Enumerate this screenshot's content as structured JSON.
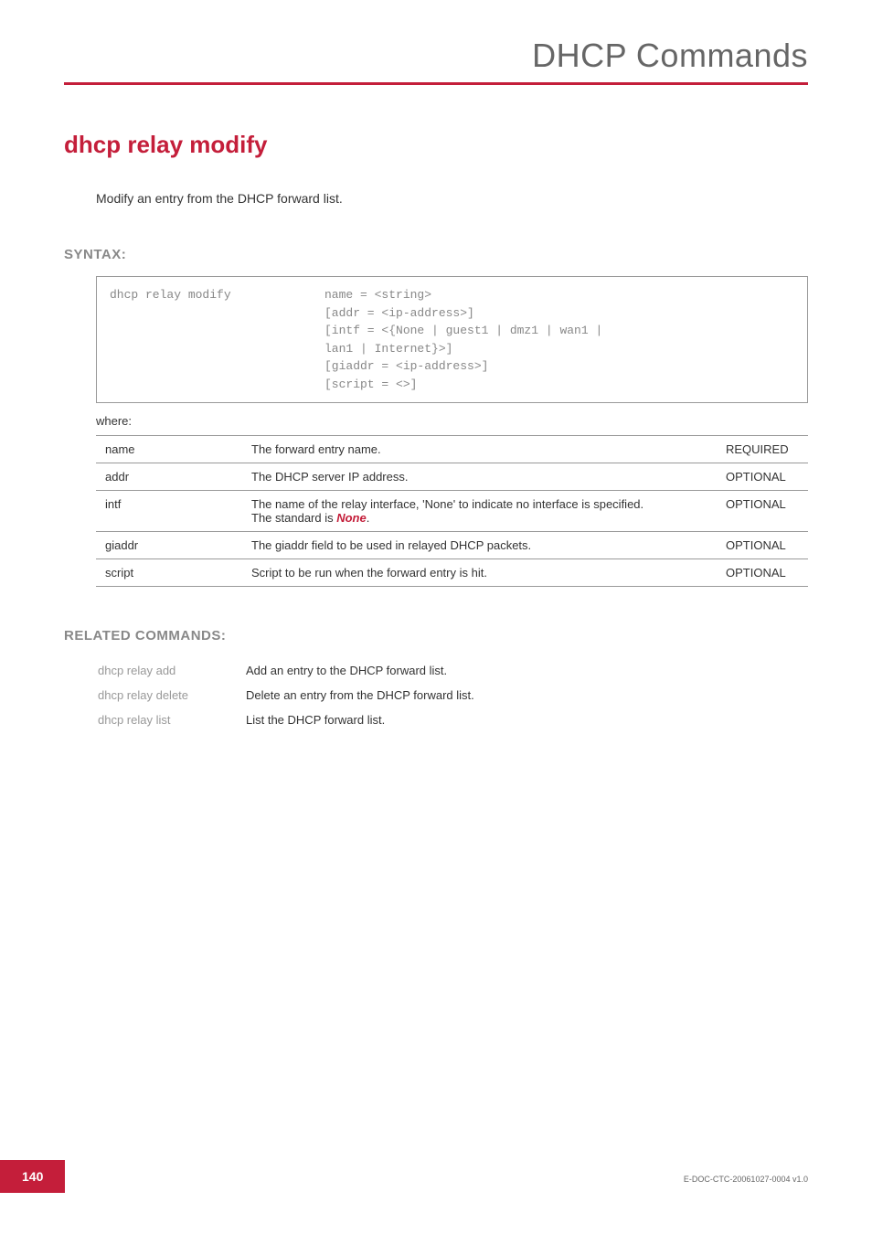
{
  "header": {
    "title": "DHCP Commands"
  },
  "command": {
    "title": "dhcp relay modify",
    "description": "Modify an entry from the DHCP forward list."
  },
  "syntax": {
    "label": "SYNTAX:",
    "command": "dhcp relay modify",
    "args": "name = <string>\n[addr = <ip-address>]\n[intf = <{None | guest1 | dmz1 | wan1 |\nlan1 | Internet}>]\n[giaddr = <ip-address>]\n[script = <>]",
    "where": "where:"
  },
  "params": [
    {
      "name": "name",
      "desc": "The forward entry name.",
      "req": "REQUIRED"
    },
    {
      "name": "addr",
      "desc": "The DHCP server IP address.",
      "req": "OPTIONAL"
    },
    {
      "name": "intf",
      "desc_pre": "The name of the relay interface, 'None' to indicate no interface is specified.\nThe standard is ",
      "desc_highlight": "None",
      "desc_post": ".",
      "req": "OPTIONAL"
    },
    {
      "name": "giaddr",
      "desc": "The giaddr field to be used in relayed DHCP packets.",
      "req": "OPTIONAL"
    },
    {
      "name": "script",
      "desc": "Script to be run when the forward entry is hit.",
      "req": "OPTIONAL"
    }
  ],
  "related": {
    "label": "RELATED COMMANDS:",
    "items": [
      {
        "cmd": "dhcp relay add",
        "desc": "Add an entry to the DHCP forward list."
      },
      {
        "cmd": "dhcp relay delete",
        "desc": "Delete an entry from the DHCP forward list."
      },
      {
        "cmd": "dhcp relay list",
        "desc": "List the DHCP forward list."
      }
    ]
  },
  "footer": {
    "page": "140",
    "docid": "E-DOC-CTC-20061027-0004 v1.0"
  }
}
